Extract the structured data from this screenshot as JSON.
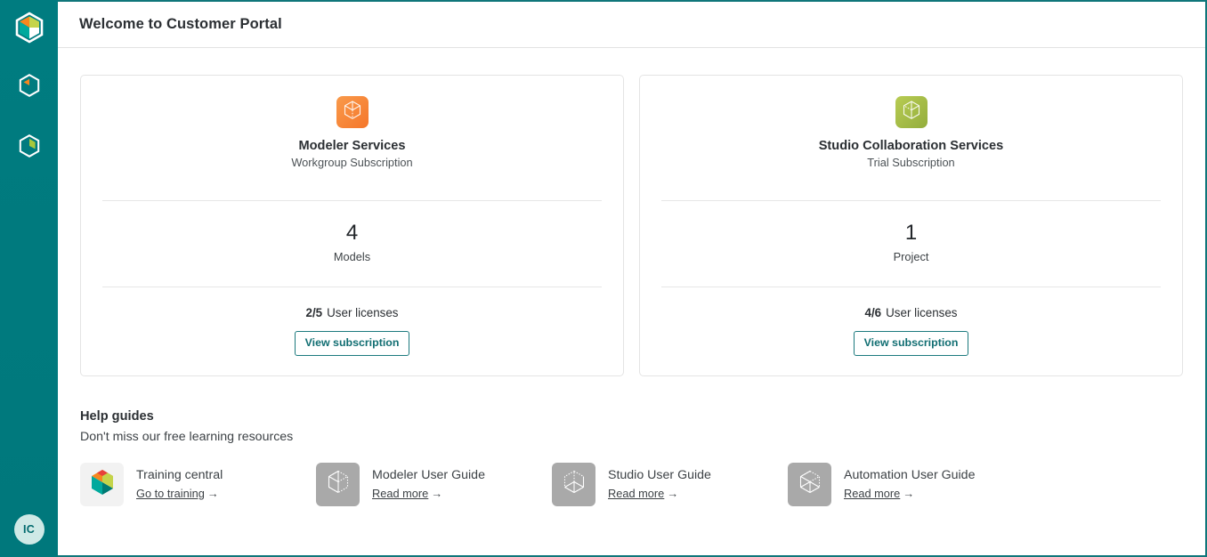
{
  "theme": {
    "sidebar_bg": "#00797d",
    "border_teal": "#10767a",
    "accent_teal": "#116e72",
    "orange": "#f5762a",
    "green": "#93ad3c",
    "grey_icon": "#a9a9a9"
  },
  "sidebar": {
    "logo": {
      "name": "app-logo-icon",
      "label": "Customer Portal logo"
    },
    "items": [
      {
        "icon": "cube-orange-segment-icon",
        "label": "Modeler"
      },
      {
        "icon": "cube-green-segment-icon",
        "label": "Studio"
      }
    ],
    "avatar": {
      "initials": "IC",
      "label": "User account"
    }
  },
  "header": {
    "title": "Welcome to Customer Portal"
  },
  "cards": [
    {
      "icon": "wireframe-cube-icon",
      "icon_style": "orange",
      "title": "Modeler Services",
      "subtitle": "Workgroup Subscription",
      "metric_value": "4",
      "metric_label": "Models",
      "licenses_used": "2",
      "licenses_separator": "/",
      "licenses_total": "5",
      "licenses_label": "User licenses",
      "button_label": "View subscription"
    },
    {
      "icon": "wireframe-cube-icon",
      "icon_style": "green",
      "title": "Studio Collaboration Services",
      "subtitle": "Trial Subscription",
      "metric_value": "1",
      "metric_label": "Project",
      "licenses_used": "4",
      "licenses_separator": "/",
      "licenses_total": "6",
      "licenses_label": "User licenses",
      "button_label": "View subscription"
    }
  ],
  "help": {
    "title": "Help guides",
    "subtitle": "Don't miss our free learning resources",
    "guides": [
      {
        "icon": "colored-cube-icon",
        "icon_style": "light",
        "name": "Training central",
        "link_label": "Go to training",
        "link_arrow": "→"
      },
      {
        "icon": "wireframe-cube-icon",
        "icon_style": "grey",
        "name": "Modeler User Guide",
        "link_label": "Read more",
        "link_arrow": "→"
      },
      {
        "icon": "wireframe-cube-icon",
        "icon_style": "grey",
        "name": "Studio User Guide",
        "link_label": "Read more",
        "link_arrow": "→"
      },
      {
        "icon": "wireframe-cube-icon",
        "icon_style": "grey",
        "name": "Automation User Guide",
        "link_label": "Read more",
        "link_arrow": "→"
      }
    ]
  }
}
